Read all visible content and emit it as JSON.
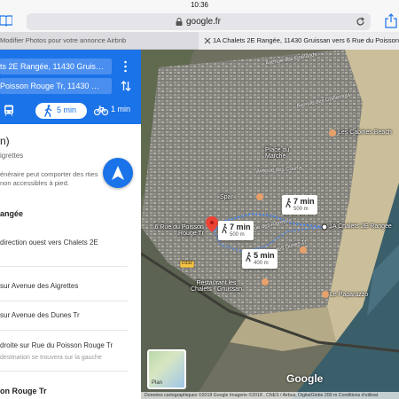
{
  "status": {
    "time": "10:36"
  },
  "browser": {
    "url": "google.fr"
  },
  "tabs": [
    {
      "label": "Modifier Photos pour votre annonce Airbnb"
    },
    {
      "label": "1A Chalets 2E Rangée, 11430 Gruissan vers 6 Rue du Poisson Rou"
    }
  ],
  "directions": {
    "origin": "ts 2E Rangée, 11430 Gruis…",
    "destination": "Poisson Rouge Tr, 11430 …",
    "modes": {
      "walk_time": "5 min",
      "bike_time": "1 min"
    },
    "summary_time": "n)",
    "summary_sub": "igrettes",
    "warning": "énéraire peut comporter des rties non accessibles à pied.",
    "steps_header": "angée",
    "steps": [
      "direction ouest vers Chalets 2E",
      "sur Avenue des Aigrettes",
      "sur Avenue des Dunes Tr",
      "droite sur Rue du Poisson Rouge Tr"
    ],
    "step_note": "destination se trouvera sur la gauche",
    "final_header": "on Rouge Tr"
  },
  "map": {
    "labels": {
      "origin": "1A Chalets 2E Rangée",
      "destination_line1": "6 Rue du Poisson",
      "destination_line2": "Rouge Tr",
      "place_du_marche_1": "Place du",
      "place_du_marche_2": "Marché",
      "cabines": "Les Cabines Beach",
      "spar": "Spar",
      "restaurant_1": "Restaurant les",
      "restaurant_2": "Chalets - Gruissan",
      "paparazzo": "Le Paparazzo",
      "road_d332": "D332"
    },
    "streets": [
      "Avenue des Goélands",
      "Avenue des Guillemots",
      "Avenue des Courlis",
      "Avenue des Aigrettes",
      "Avenue des Dunes Tr"
    ],
    "route_boxes": [
      {
        "time": "7 min",
        "dist": "500 m"
      },
      {
        "time": "7 min",
        "dist": "500 m"
      },
      {
        "time": "5 min",
        "dist": "400 m"
      }
    ],
    "plan_label": "Plan",
    "google": "Google",
    "attribution": "Données cartographiques ©2018 Google Imagerie ©2018 , CNES / Airbus, DigitalGlobe    200 m      Conditions d'utilisat"
  },
  "colors": {
    "accent": "#1a73e8",
    "route": "#4285f4",
    "destination_pin": "#ea4335"
  }
}
